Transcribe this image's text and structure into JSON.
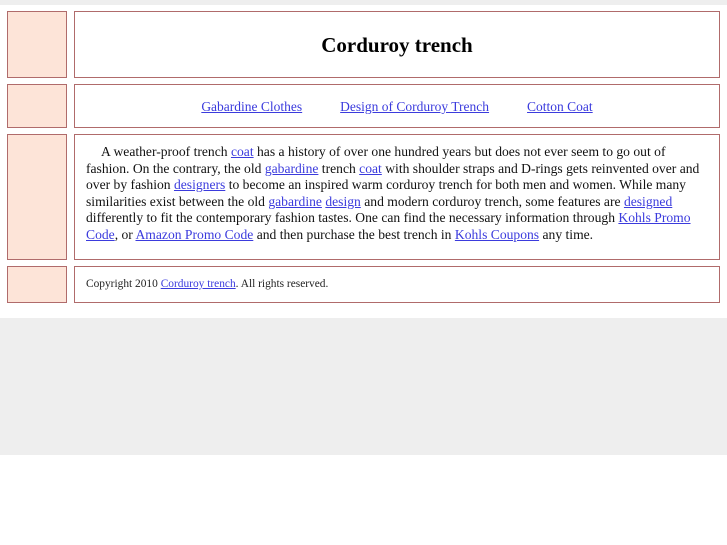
{
  "site": {
    "title": "Corduroy trench"
  },
  "nav": {
    "links": [
      {
        "label": "Gabardine Clothes"
      },
      {
        "label": "Design of Corduroy Trench"
      },
      {
        "label": "Cotton Coat"
      }
    ]
  },
  "article": {
    "segments": [
      {
        "type": "text",
        "text": "A weather-proof trench "
      },
      {
        "type": "link",
        "text": "coat"
      },
      {
        "type": "text",
        "text": " has a history of over one hundred years but does not ever seem to go out of fashion. On the contrary, the old "
      },
      {
        "type": "link",
        "text": "gabardine"
      },
      {
        "type": "text",
        "text": " trench "
      },
      {
        "type": "link",
        "text": "coat"
      },
      {
        "type": "text",
        "text": " with shoulder straps and D-rings gets reinvented over and over by fashion "
      },
      {
        "type": "link",
        "text": "designers"
      },
      {
        "type": "text",
        "text": " to become an inspired warm corduroy trench for both men and women. While many similarities exist between the old "
      },
      {
        "type": "link",
        "text": "gabardine"
      },
      {
        "type": "text",
        "text": " "
      },
      {
        "type": "link",
        "text": "design"
      },
      {
        "type": "text",
        "text": " and modern corduroy trench, some features are "
      },
      {
        "type": "link",
        "text": "designed"
      },
      {
        "type": "text",
        "text": " differently to fit the contemporary fashion tastes. One can find the necessary information through "
      },
      {
        "type": "link",
        "text": "Kohls Promo Code"
      },
      {
        "type": "text",
        "text": ", or "
      },
      {
        "type": "link",
        "text": "Amazon Promo Code"
      },
      {
        "type": "text",
        "text": " and then purchase the best trench in "
      },
      {
        "type": "link",
        "text": "Kohls Coupons"
      },
      {
        "type": "text",
        "text": " any time."
      }
    ]
  },
  "footer": {
    "prefix": "Copyright 2010 ",
    "link": "Corduroy trench",
    "suffix": ". All rights reserved."
  },
  "sidebar": {
    "boxes": [
      {
        "name": "header-sidebar-box"
      },
      {
        "name": "nav-sidebar-box"
      },
      {
        "name": "content-sidebar-box"
      },
      {
        "name": "footer-sidebar-box"
      }
    ]
  },
  "colors": {
    "box_fill": "#fde4d8",
    "box_border": "#b06b6b",
    "link": "#3b3bdd",
    "backdrop": "#eeeeee",
    "page": "#ffffff"
  }
}
